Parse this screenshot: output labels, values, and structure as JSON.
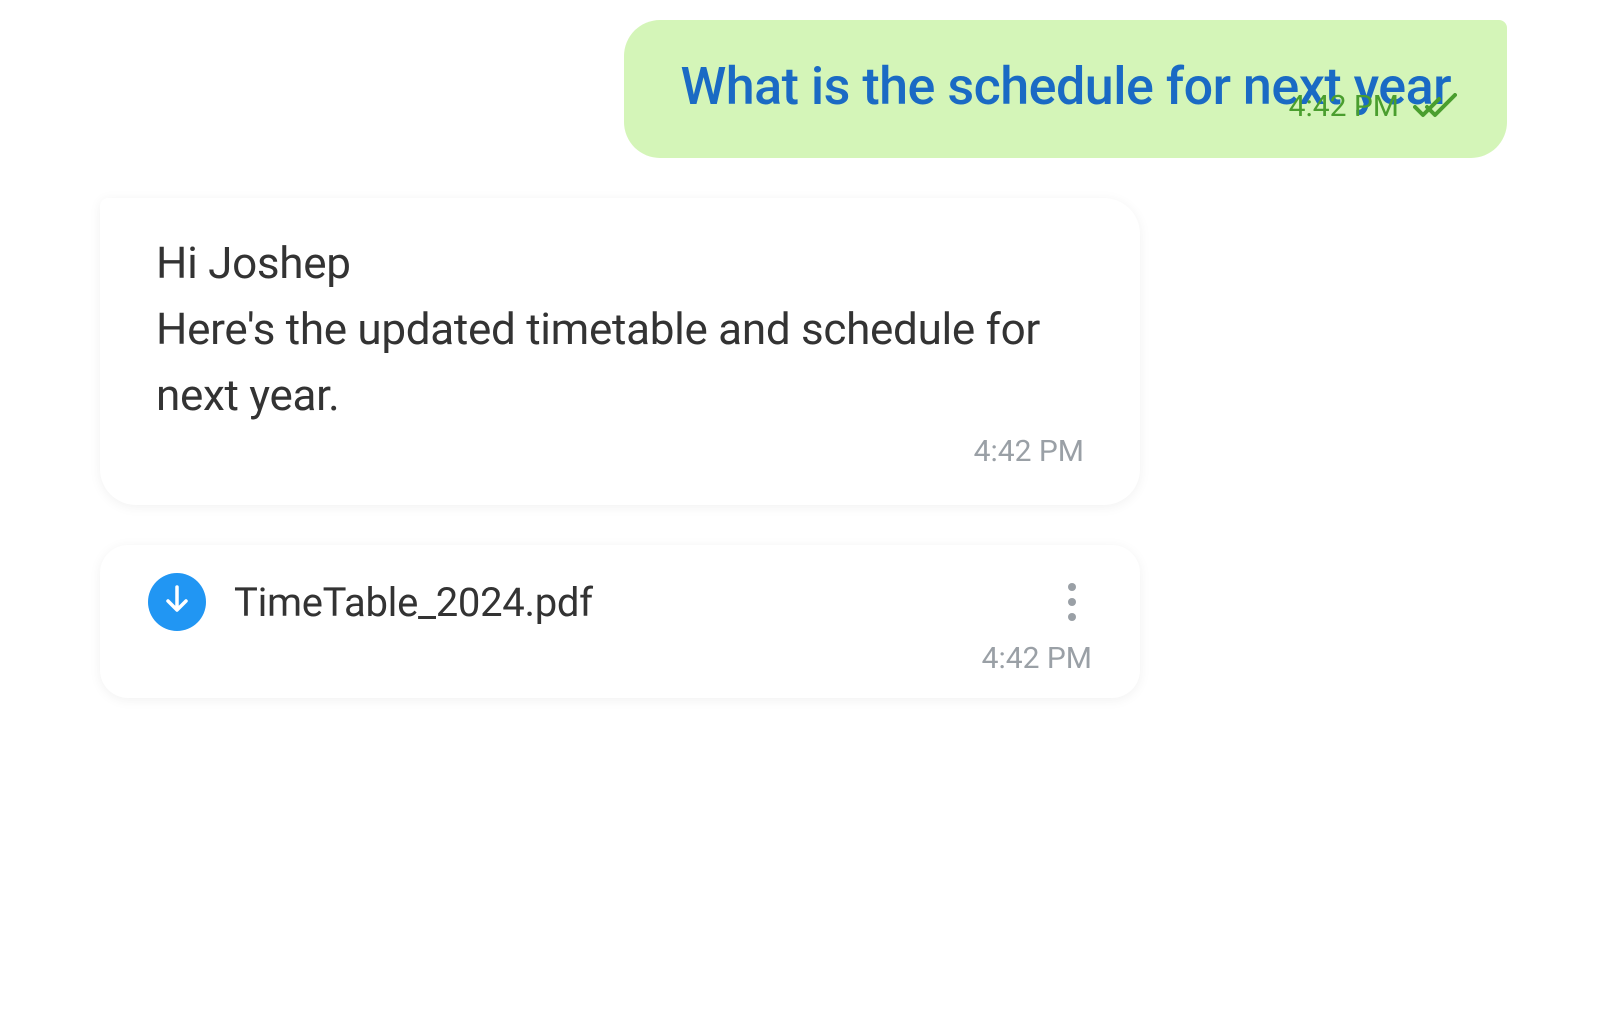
{
  "messages": {
    "outgoing": {
      "text": "What is the schedule for next year",
      "time": "4:42 PM",
      "status": "read"
    },
    "incoming_text": {
      "text": "Hi Joshep\nHere's the updated timetable and schedule for next year.",
      "time": "4:42 PM"
    },
    "file": {
      "name": "TimeTable_2024.pdf",
      "time": "4:42 PM"
    }
  },
  "colors": {
    "outgoing_bubble": "#d4f5b8",
    "outgoing_text": "#1a6ac4",
    "delivered": "#4a9e2e",
    "received_time": "#9aa0a6",
    "download_button": "#2196f3"
  }
}
